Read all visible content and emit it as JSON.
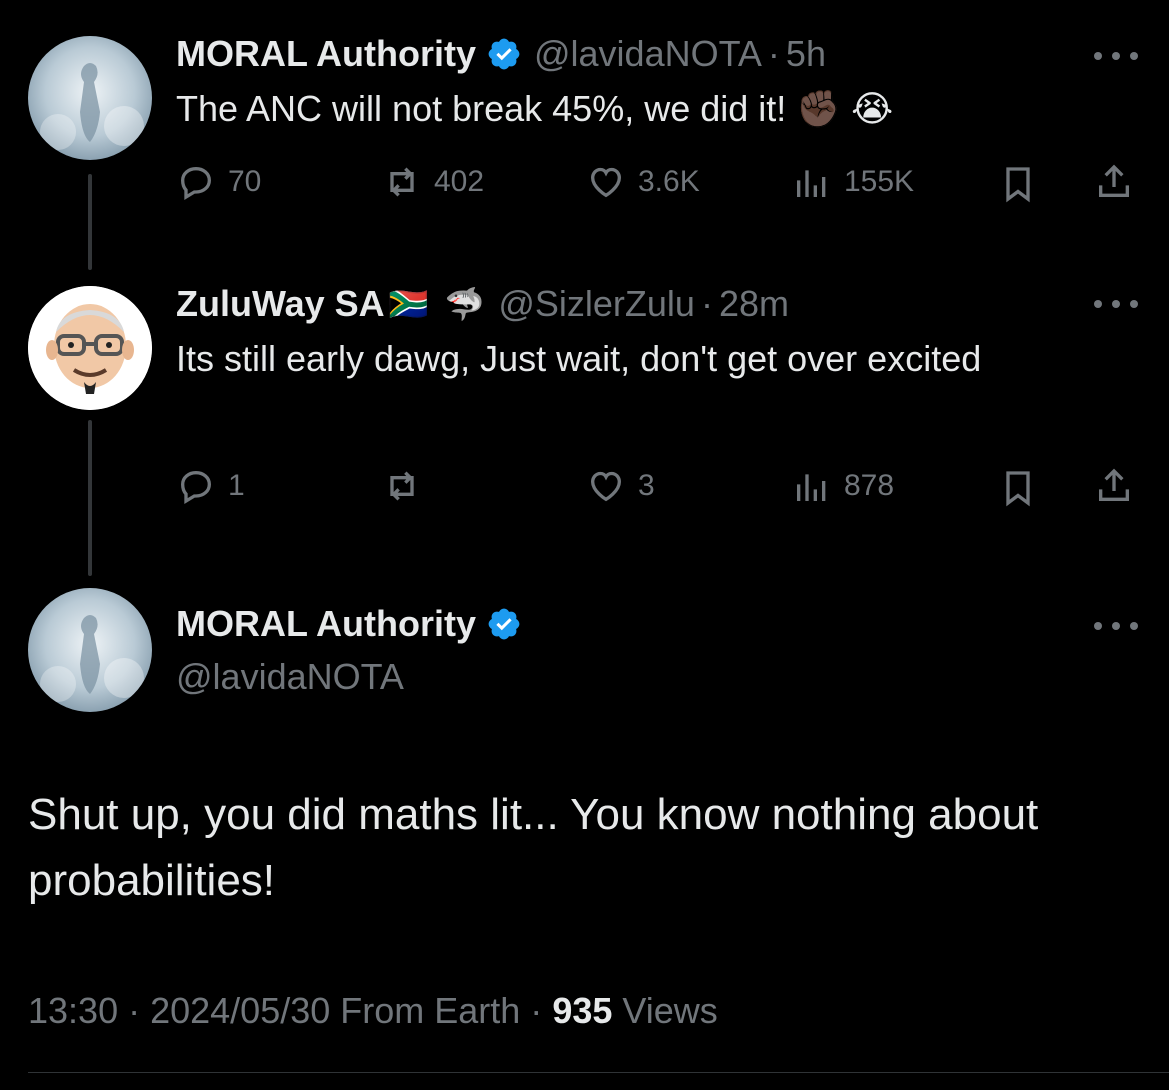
{
  "tweet1": {
    "name": "MORAL Authority",
    "handle": "@lavidaNOTA",
    "sep": "·",
    "time": "5h",
    "text": "The ANC will not break 45%, we did it!",
    "emoji": "✊🏿 😭",
    "replies": "70",
    "retweets": "402",
    "likes": "3.6K",
    "views": "155K"
  },
  "tweet2": {
    "name": "ZuluWay SA",
    "flag_emoji": "🇿🇦",
    "shark_emoji": "🦈",
    "handle": "@SizlerZulu",
    "sep": "·",
    "time": "28m",
    "text": "Its still early dawg, Just wait, don't get over excited",
    "replies": "1",
    "retweets": "",
    "likes": "3",
    "views": "878"
  },
  "main_tweet": {
    "name": "MORAL Authority",
    "handle": "@lavidaNOTA",
    "text": "Shut up, you did maths lit... You know nothing about probabilities!",
    "footer_time": "13:30 · 2024/05/30 From Earth ·",
    "footer_views_count": "935",
    "footer_views_label": "Views"
  },
  "colors": {
    "background": "#000000",
    "text": "#e7e9ea",
    "muted": "#71767b",
    "verified_blue": "#1d9bf0",
    "thread_line": "#333639"
  }
}
